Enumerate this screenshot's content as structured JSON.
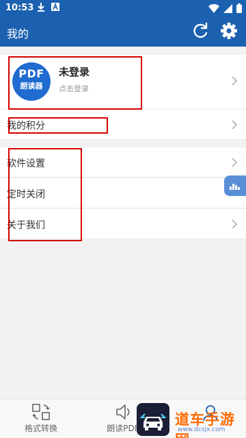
{
  "status": {
    "time": "10:53"
  },
  "appbar": {
    "title": "我的"
  },
  "profile": {
    "avatar_line1": "PDF",
    "avatar_line2": "朗读器",
    "name": "未登录",
    "subtitle": "点击登录"
  },
  "points": {
    "label": "我的积分"
  },
  "menu": {
    "items": [
      {
        "label": "软件设置"
      },
      {
        "label": "定时关闭"
      },
      {
        "label": "关于我们"
      }
    ]
  },
  "bottom_nav": {
    "items": [
      {
        "label": "格式转换",
        "icon": "format-convert-icon"
      },
      {
        "label": "朗读PDF",
        "icon": "speaker-icon"
      },
      {
        "label": "",
        "icon": "profile-icon"
      }
    ]
  },
  "watermark": {
    "text": "道车手游网",
    "url": "www.dcsjx.com"
  },
  "colors": {
    "primary": "#1c61b0",
    "annotation": "#d40000",
    "watermark": "#ff6a00"
  }
}
